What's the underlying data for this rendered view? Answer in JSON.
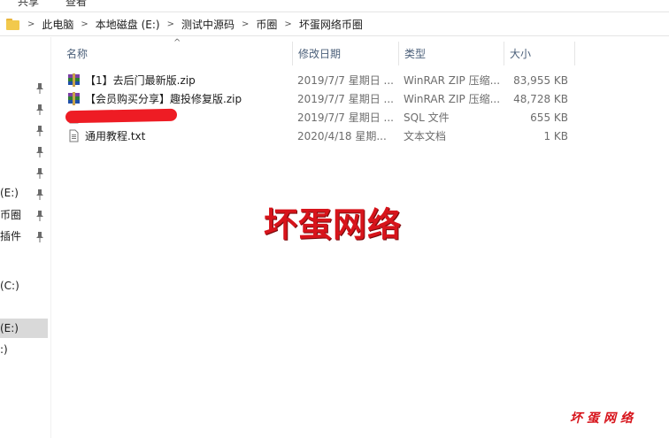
{
  "ribbon": {
    "tab_a": "共享",
    "tab_b": "查看"
  },
  "breadcrumb": [
    "此电脑",
    "本地磁盘 (E:)",
    "测试中源码",
    "币圈",
    "坏蛋网络币圈"
  ],
  "nav": {
    "items": [
      {
        "label": "(E:)"
      },
      {
        "label": "币圈"
      },
      {
        "label": "插件"
      },
      {
        "label": "(C:)"
      },
      {
        "label": "(E:)"
      },
      {
        "label": ":)"
      }
    ]
  },
  "columns": {
    "name": "名称",
    "modified": "修改日期",
    "type": "类型",
    "size": "大小"
  },
  "files": [
    {
      "name": "【1】去后门最新版.zip",
      "modified": "2019/7/7 星期日 ...",
      "type": "WinRAR ZIP 压缩...",
      "size": "83,955 KB",
      "icon": "winrar-zip-icon"
    },
    {
      "name": "【会员购买分享】趣投修复版.zip",
      "modified": "2019/7/7 星期日 ...",
      "type": "WinRAR ZIP 压缩...",
      "size": "48,728 KB",
      "icon": "winrar-zip-icon"
    },
    {
      "name": "",
      "modified": "2019/7/7 星期日 ...",
      "type": "SQL 文件",
      "size": "655 KB",
      "icon": "sql-file-icon"
    },
    {
      "name": "通用教程.txt",
      "modified": "2020/4/18 星期...",
      "type": "文本文档",
      "size": "1 KB",
      "icon": "text-file-icon"
    }
  ],
  "watermark": {
    "main": "坏蛋网络",
    "corner": "坏蛋网络"
  },
  "colors": {
    "watermark": "#d7141b",
    "selected_nav": "#d9d9d9",
    "header_text": "#4c607a"
  }
}
